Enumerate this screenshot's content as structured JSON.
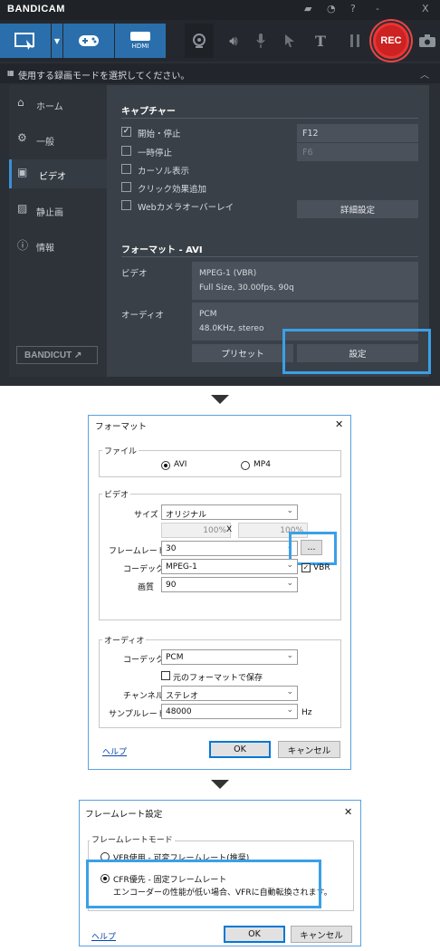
{
  "app": {
    "title": "BANDICAM",
    "titlebar_icons": [
      "folder-icon",
      "clock-icon",
      "help-icon",
      "minimize-icon",
      "close-icon"
    ],
    "titlebar_glyphs": [
      "▰",
      "◔",
      "?",
      "-",
      "X"
    ],
    "rec_label": "REC",
    "hdmi_label": "HDMI",
    "mode_text": "使用する録画モードを選択してください。",
    "sidebar": [
      {
        "label": "ホーム",
        "icon": "home-icon",
        "glyph": "⌂"
      },
      {
        "label": "一般",
        "icon": "gear-icon",
        "glyph": "⚙"
      },
      {
        "label": "ビデオ",
        "icon": "video-icon",
        "glyph": "▣"
      },
      {
        "label": "静止画",
        "icon": "image-icon",
        "glyph": "▨"
      },
      {
        "label": "情報",
        "icon": "info-icon",
        "glyph": "ⓘ"
      }
    ],
    "bandicut": "BANDICUT ↗",
    "capture": {
      "title": "キャプチャー",
      "options": [
        {
          "label": "開始・停止",
          "checked": true,
          "key": "F12"
        },
        {
          "label": "一時停止",
          "checked": false,
          "key": "F6"
        },
        {
          "label": "カーソル表示",
          "checked": false
        },
        {
          "label": "クリック効果追加",
          "checked": false
        },
        {
          "label": "Webカメラオーバーレイ",
          "checked": false
        }
      ],
      "advanced_button": "詳細設定"
    },
    "format": {
      "title": "フォーマット - AVI",
      "video_label": "ビデオ",
      "video_line1": "MPEG-1 (VBR)",
      "video_line2": "Full Size, 30.00fps, 90q",
      "audio_label": "オーディオ",
      "audio_line1": "PCM",
      "audio_line2": "48.0KHz, stereo",
      "preset_button": "プリセット",
      "settings_button": "設定"
    }
  },
  "format_dialog": {
    "title": "フォーマット",
    "close": "✕",
    "file_group": "ファイル",
    "file_options": [
      {
        "label": "AVI",
        "selected": true
      },
      {
        "label": "MP4",
        "selected": false
      }
    ],
    "video_group": "ビデオ",
    "size_label": "サイズ",
    "size_value": "オリジナル",
    "width_pct": "100%",
    "x_label": "X",
    "height_pct": "100%",
    "framerate_label": "フレームレート",
    "framerate_value": "30",
    "more_button": "...",
    "codec_label": "コーデック",
    "codec_value": "MPEG-1",
    "vbr_label": "VBR",
    "quality_label": "画質",
    "quality_value": "90",
    "audio_group": "オーディオ",
    "acodec_label": "コーデック",
    "acodec_value": "PCM",
    "keep_format_label": "元のフォーマットで保存",
    "channel_label": "チャンネル",
    "channel_value": "ステレオ",
    "samplerate_label": "サンプルレート",
    "samplerate_value": "48000",
    "hz_label": "Hz",
    "help": "ヘルプ",
    "ok": "OK",
    "cancel": "キャンセル"
  },
  "framerate_dialog": {
    "title": "フレームレート設定",
    "close": "✕",
    "group": "フレームレートモード",
    "vfr_option": "VFR使用 - 可変フレームレート(推奨)",
    "cfr_option": "CFR優先 - 固定フレームレート",
    "cfr_note": "エンコーダーの性能が低い場合、VFRに自動転換されます。",
    "help": "ヘルプ",
    "ok": "OK",
    "cancel": "キャンセル"
  },
  "colors": {
    "accent": "#2a6fab",
    "highlight": "#3aa0e8",
    "rec": "#cc2222"
  }
}
